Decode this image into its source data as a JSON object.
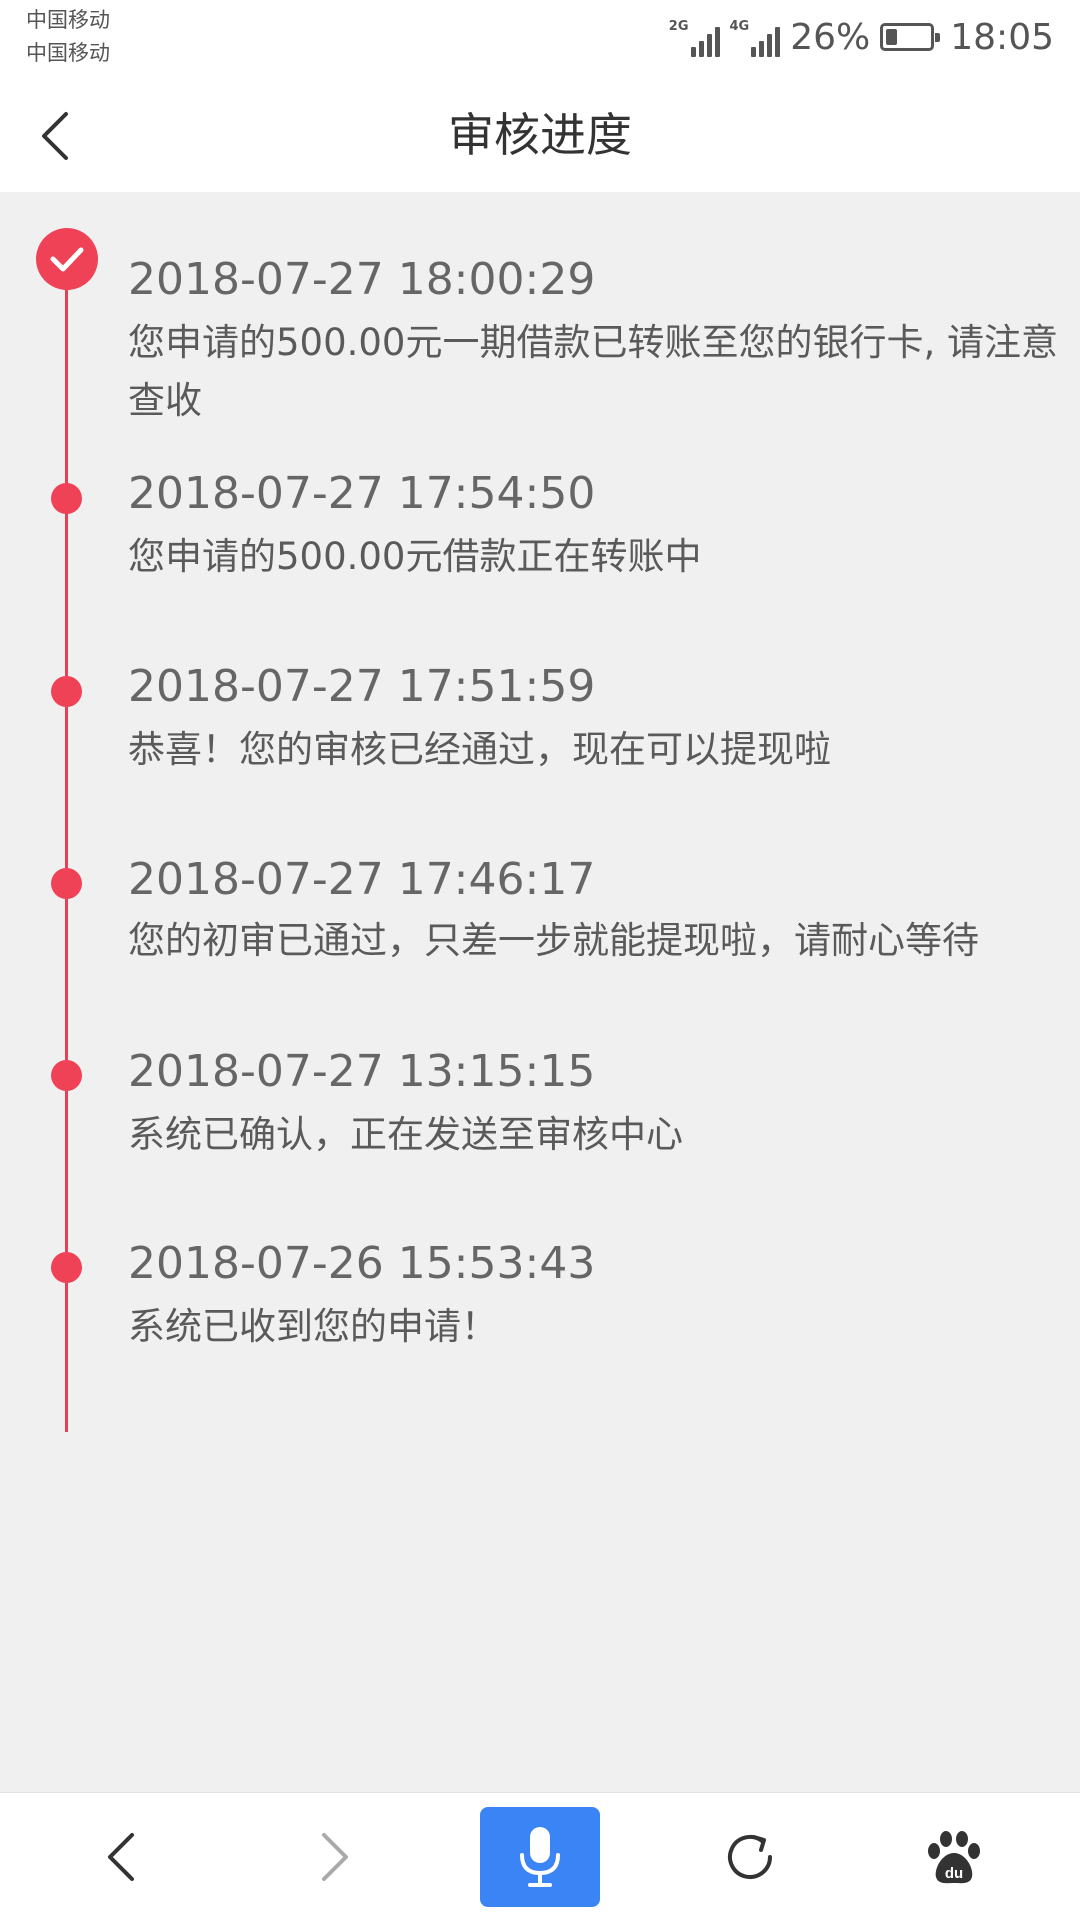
{
  "status_bar": {
    "carrier_1": "中国移动",
    "carrier_2": "中国移动",
    "net_1": "2G",
    "net_2": "4G",
    "battery_percent": "26%",
    "battery_level": 0.26,
    "time": "18:05"
  },
  "header": {
    "title": "审核进度",
    "back_icon": "chevron-left-icon"
  },
  "timeline": {
    "accent_color": "#f04257",
    "items": [
      {
        "time": "2018-07-27 18:00:29",
        "text": "您申请的500.00元一期借款已转账至您的银行卡, 请注意查收",
        "marker": "check"
      },
      {
        "time": "2018-07-27 17:54:50",
        "text": "您申请的500.00元借款正在转账中",
        "marker": "dot"
      },
      {
        "time": "2018-07-27 17:51:59",
        "text": "恭喜！您的审核已经通过，现在可以提现啦",
        "marker": "dot"
      },
      {
        "time": "2018-07-27 17:46:17",
        "text": "您的初审已通过，只差一步就能提现啦，请耐心等待",
        "marker": "dot"
      },
      {
        "time": "2018-07-27 13:15:15",
        "text": "系统已确认，正在发送至审核中心",
        "marker": "dot"
      },
      {
        "time": "2018-07-26 15:53:43",
        "text": "系统已收到您的申请！",
        "marker": "dot"
      }
    ]
  },
  "bottom_bar": {
    "back_icon": "chevron-left-icon",
    "forward_icon": "chevron-right-icon",
    "mic_icon": "microphone-icon",
    "mic_color": "#3b84f5",
    "refresh_icon": "refresh-icon",
    "baidu_icon": "baidu-paw-icon",
    "baidu_text": "du"
  }
}
